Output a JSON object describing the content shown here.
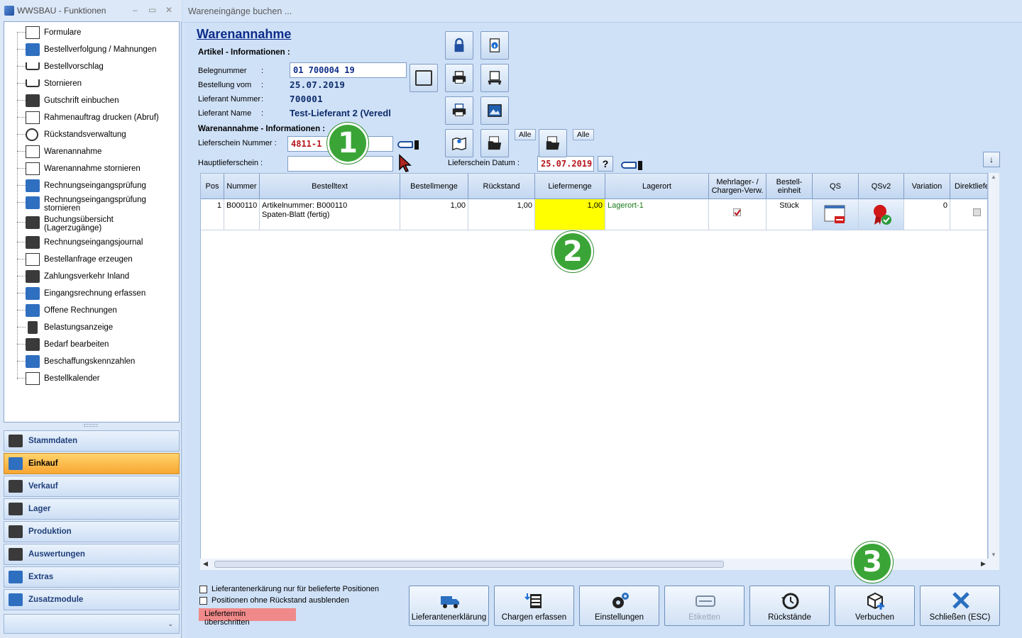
{
  "left": {
    "title": "WWSBAU - Funktionen",
    "window_controls": [
      "–",
      "▭",
      "✕"
    ],
    "tree": [
      {
        "label": "Formulare",
        "icon": "document-icon"
      },
      {
        "label": "Bestellverfolgung / Mahnungen",
        "icon": "map-icon"
      },
      {
        "label": "Bestellvorschlag",
        "icon": "cart-icon"
      },
      {
        "label": "Stornieren",
        "icon": "cart-cancel-icon"
      },
      {
        "label": "Gutschrift einbuchen",
        "icon": "monitor-icon"
      },
      {
        "label": "Rahmenauftrag drucken (Abruf)",
        "icon": "print-document-icon"
      },
      {
        "label": "Rückstandsverwaltung",
        "icon": "clock-icon"
      },
      {
        "label": "Warenannahme",
        "icon": "receive-icon"
      },
      {
        "label": "Warenannahme stornieren",
        "icon": "receive-cancel-icon"
      },
      {
        "label": "Rechnungseingangsprüfung",
        "icon": "invoice-check-icon"
      },
      {
        "label": "Rechnungseingangsprüfung stornieren",
        "icon": "invoice-cancel-icon"
      },
      {
        "label": "Buchungsübersicht (Lagerzugänge)",
        "icon": "list-icon"
      },
      {
        "label": "Rechnungseingangsjournal",
        "icon": "journal-icon"
      },
      {
        "label": "Bestellanfrage erzeugen",
        "icon": "request-icon"
      },
      {
        "label": "Zahlungsverkehr Inland",
        "icon": "money-icon"
      },
      {
        "label": "Eingangsrechnung erfassen",
        "icon": "euro-icon"
      },
      {
        "label": "Offene Rechnungen",
        "icon": "euro-open-icon"
      },
      {
        "label": "Belastungsanzeige",
        "icon": "weight-icon"
      },
      {
        "label": "Bedarf bearbeiten",
        "icon": "keyboard-icon"
      },
      {
        "label": "Beschaffungskennzahlen",
        "icon": "chart-info-icon"
      },
      {
        "label": "Bestellkalender",
        "icon": "calendar-icon"
      }
    ],
    "nav": [
      {
        "label": "Stammdaten",
        "icon": "master-data-icon",
        "active": false
      },
      {
        "label": "Einkauf",
        "icon": "shopping-cart-icon",
        "active": true
      },
      {
        "label": "Verkauf",
        "icon": "cash-register-icon",
        "active": false
      },
      {
        "label": "Lager",
        "icon": "warehouse-icon",
        "active": false
      },
      {
        "label": "Produktion",
        "icon": "production-icon",
        "active": false
      },
      {
        "label": "Auswertungen",
        "icon": "analytics-icon",
        "active": false
      },
      {
        "label": "Extras",
        "icon": "extras-icon",
        "active": false
      },
      {
        "label": "Zusatzmodule",
        "icon": "modules-icon",
        "active": false
      }
    ],
    "nav_more": "⌄"
  },
  "window": {
    "title": "Wareneingänge buchen ..."
  },
  "form": {
    "page_title": "Warenannahme",
    "artikel_section": "Artikel - Informationen :",
    "belegnummer_label": "Belegnummer",
    "belegnummer_value": "01 700004 19",
    "bestellung_label": "Bestellung vom",
    "bestellung_value": "25.07.2019",
    "lieferant_nr_label": "Lieferant Nummer",
    "lieferant_nr_value": "700001",
    "lieferant_name_label": "Lieferant Name",
    "lieferant_name_value": "Test-Lieferant 2 (Veredl",
    "colon": ":",
    "warenannahme_section": "Warenannahme - Informationen :",
    "lieferschein_label": "Lieferschein Nummer :",
    "lieferschein_value": "4811-1",
    "hauptlieferschein_label": "Hauptlieferschein :",
    "hauptlieferschein_value": "",
    "lieferschein_datum_label": "Lieferschein Datum :",
    "lieferschein_datum_value": "25.07.2019",
    "help_label": "?",
    "alle_label": "Alle"
  },
  "badges": [
    "1",
    "2",
    "3"
  ],
  "grid": {
    "columns": [
      "Pos",
      "Nummer",
      "Bestelltext",
      "Bestellmenge",
      "Rückstand",
      "Liefermenge",
      "Lagerort",
      "Mehrlager- / Chargen-Verw.",
      "Bestell- einheit",
      "QS",
      "QSv2",
      "Variation",
      "Direktliefe"
    ],
    "rows": [
      {
        "pos": "1",
        "nummer": "B000110",
        "text1": "Artikelnummer: B000110",
        "text2": "Spaten-Blatt (fertig)",
        "bestellmenge": "1,00",
        "rueckstand": "1,00",
        "liefermenge": "1,00",
        "lagerort": "Lagerort-1",
        "einheit": "Stück",
        "variation": "0"
      }
    ]
  },
  "footer": {
    "check1": "Lieferantenerkärung nur für belieferte Positionen",
    "check2": "Positionen ohne Rückstand ausblenden",
    "warning": "Liefertermin überschritten",
    "buttons": [
      {
        "label": "Lieferantenerklärung",
        "icon": "truck-icon",
        "enabled": true
      },
      {
        "label": "Chargen erfassen",
        "icon": "batch-icon",
        "enabled": true
      },
      {
        "label": "Einstellungen",
        "icon": "settings-gears-icon",
        "enabled": true
      },
      {
        "label": "Etiketten",
        "icon": "label-icon",
        "enabled": false
      },
      {
        "label": "Rückstände",
        "icon": "history-icon",
        "enabled": true
      },
      {
        "label": "Verbuchen",
        "icon": "box-add-icon",
        "enabled": true
      },
      {
        "label": "Schließen (ESC)",
        "icon": "close-x-icon",
        "enabled": true
      }
    ]
  },
  "colors": {
    "accent_orange": "#f8a632",
    "badge_green": "#3aa536",
    "highlight_yellow": "#ffff00",
    "warning_red": "#f08a8a"
  }
}
